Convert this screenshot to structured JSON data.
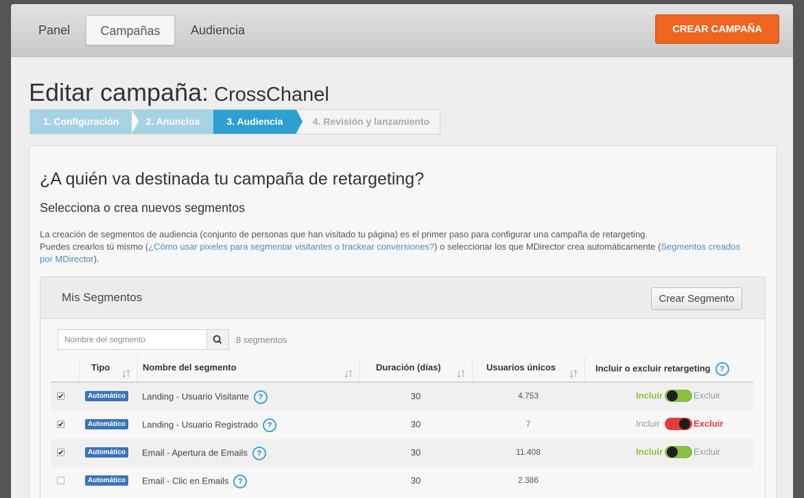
{
  "nav": {
    "tabs": [
      {
        "label": "Panel"
      },
      {
        "label": "Campañas"
      },
      {
        "label": "Audiencia"
      }
    ],
    "create_button": "CREAR CAMPAÑA"
  },
  "page": {
    "title": "Editar campaña:",
    "campaign_name": "CrossChanel"
  },
  "steps": [
    {
      "label": "1. Configuración",
      "state": "done"
    },
    {
      "label": "2. Anuncios",
      "state": "done"
    },
    {
      "label": "3. Audiencia",
      "state": "current"
    },
    {
      "label": "4. Revisión y lanzamiento",
      "state": "pending"
    }
  ],
  "content": {
    "question": "¿A quién va destinada tu campaña de retargeting?",
    "subtitle": "Selecciona o crea nuevos segmentos",
    "desc_line1": "La creación de segmentos de audiencia (conjunto de personas que han visitado tu página) es el primer paso para configurar una campaña de retargeting.",
    "desc_line2_pre": "Puedes crearlos tú mismo (",
    "desc_link1": "¿Cómo usar pixeles para segmentar visitantes o trackear conversiones?",
    "desc_line2_mid": ") o seleccionar los que MDirector crea automáticamente (",
    "desc_link2": "Segmentos creados por MDirector",
    "desc_line2_end": ")."
  },
  "segments_panel": {
    "title": "Mis Segmentos",
    "create_button": "Crear Segmento",
    "search_placeholder": "Nombre del segmento",
    "count_label": "8 segmentos",
    "columns": {
      "tipo": "Tipo",
      "nombre": "Nombre del segmento",
      "duracion": "Duración (días)",
      "usuarios": "Usuarios únicos",
      "retargeting": "Incluir o excluir retargeting"
    },
    "toggle_labels": {
      "include": "Incluir",
      "exclude": "Excluir"
    },
    "rows": [
      {
        "checked": true,
        "type": "Automático",
        "name": "Landing - Usuario Visitante",
        "duration": "30",
        "users": "4.753",
        "mode": "include"
      },
      {
        "checked": true,
        "type": "Automático",
        "name": "Landing - Usuario Registrado",
        "duration": "30",
        "users": "7",
        "mode": "exclude"
      },
      {
        "checked": true,
        "type": "Automático",
        "name": "Email - Apertura de Emails",
        "duration": "30",
        "users": "11.408",
        "mode": "include"
      },
      {
        "checked": false,
        "type": "Automático",
        "name": "Email - Clic en Emails",
        "duration": "30",
        "users": "2.386",
        "mode": "none"
      }
    ]
  },
  "colors": {
    "accent_orange": "#ee6420",
    "step_current": "#2d9fd0",
    "step_done": "#a6d3e4",
    "badge_blue": "#3a73b8",
    "toggle_include": "#8cbf3f",
    "toggle_exclude": "#e63b3b",
    "link": "#4d8cc0"
  }
}
